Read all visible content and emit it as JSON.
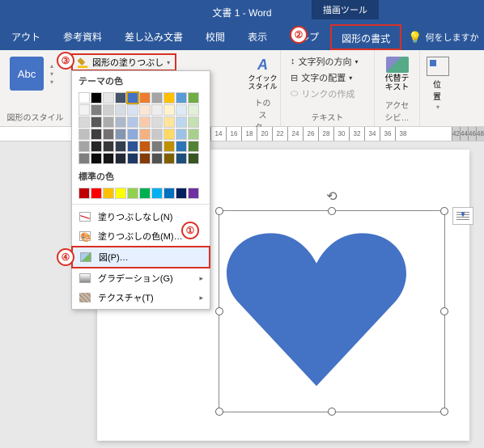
{
  "title": "文書 1  -  Word",
  "tool_tab": "描画ツール",
  "signature": "",
  "tabs": {
    "layout": "アウト",
    "references": "参考資料",
    "mailings": "差し込み文書",
    "review": "校閲",
    "view": "表示",
    "help": "ヘルプ",
    "shape_format": "図形の書式",
    "tell_me": "何をしますか"
  },
  "ribbon": {
    "abc": "Abc",
    "shape_styles_label": "図形のスタイル",
    "shape_fill_label": "図形の塗りつぶし",
    "quick_style": "クイック\nスタイル",
    "wordart_label": "トのスタ…",
    "text_direction": "文字列の方向",
    "text_align": "文字の配置",
    "create_link": "リンクの作成",
    "text_label": "テキスト",
    "alt_text": "代替テ\nキスト",
    "access_label": "アクセシビ…",
    "position": "位置"
  },
  "dropdown": {
    "theme_colors": "テーマの色",
    "standard_colors": "標準の色",
    "no_fill": "塗りつぶしなし(N)",
    "more_colors": "塗りつぶしの色(M)…",
    "picture": "図(P)…",
    "gradient": "グラデーション(G)",
    "texture": "テクスチャ(T)"
  },
  "theme_palette": [
    [
      "#ffffff",
      "#000000",
      "#e7e6e6",
      "#44546a",
      "#4472c4",
      "#ed7d31",
      "#a5a5a5",
      "#ffc000",
      "#5b9bd5",
      "#70ad47"
    ],
    [
      "#f2f2f2",
      "#7f7f7f",
      "#d0cece",
      "#d6dce4",
      "#d9e2f3",
      "#fbe5d5",
      "#ededed",
      "#fff2cc",
      "#deebf6",
      "#e2efd9"
    ],
    [
      "#d8d8d8",
      "#595959",
      "#aeabab",
      "#adb9ca",
      "#b4c6e7",
      "#f7cbac",
      "#dbdbdb",
      "#fee599",
      "#bdd7ee",
      "#c5e0b3"
    ],
    [
      "#bfbfbf",
      "#3f3f3f",
      "#757070",
      "#8496b0",
      "#8eaadb",
      "#f4b183",
      "#c9c9c9",
      "#ffd965",
      "#9cc3e5",
      "#a8d08d"
    ],
    [
      "#a5a5a5",
      "#262626",
      "#3a3838",
      "#323f4f",
      "#2f5496",
      "#c55a11",
      "#7b7b7b",
      "#bf9000",
      "#2e75b5",
      "#538135"
    ],
    [
      "#7f7f7f",
      "#0c0c0c",
      "#171616",
      "#222a35",
      "#1f3864",
      "#833c0b",
      "#525252",
      "#7f6000",
      "#1e4e79",
      "#375623"
    ]
  ],
  "standard_palette": [
    "#c00000",
    "#ff0000",
    "#ffc000",
    "#ffff00",
    "#92d050",
    "#00b050",
    "#00b0f0",
    "#0070c0",
    "#002060",
    "#7030a0"
  ],
  "ruler_ticks": [
    "14",
    "16",
    "18",
    "20",
    "22",
    "24",
    "26",
    "28",
    "30",
    "32",
    "34",
    "36",
    "38"
  ],
  "ruler_dark_ticks": [
    "42",
    "44",
    "46",
    "48"
  ],
  "callouts": {
    "c1": "①",
    "c2": "②",
    "c3": "③",
    "c4": "④"
  }
}
